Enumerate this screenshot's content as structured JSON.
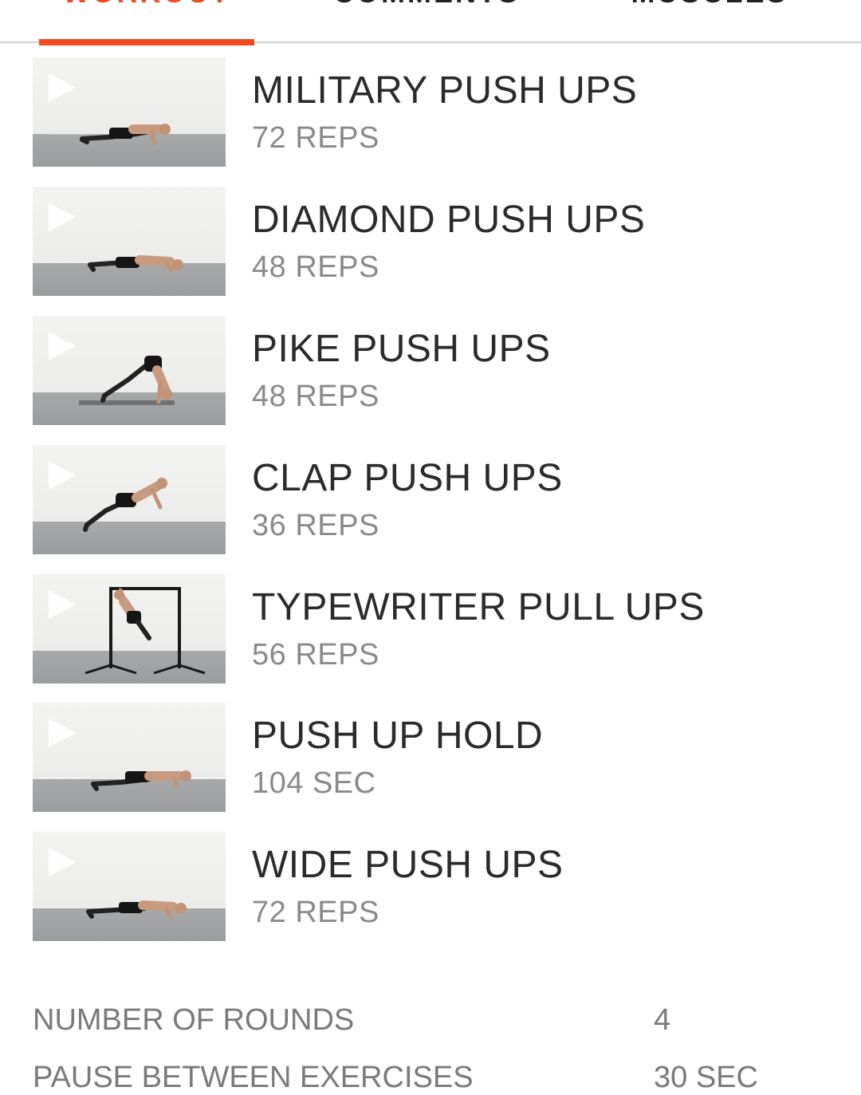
{
  "tabs": [
    {
      "label": "WORKOUT",
      "active": true
    },
    {
      "label": "COMMENTS",
      "active": false
    },
    {
      "label": "MUSCLES",
      "active": false
    }
  ],
  "accent_color": "#f04b1c",
  "exercises": [
    {
      "name": "MILITARY PUSH UPS",
      "amount": "72 REPS",
      "thumb_icon": "play-icon"
    },
    {
      "name": "DIAMOND PUSH UPS",
      "amount": "48 REPS",
      "thumb_icon": "play-icon"
    },
    {
      "name": "PIKE PUSH UPS",
      "amount": "48 REPS",
      "thumb_icon": "play-icon"
    },
    {
      "name": "CLAP PUSH UPS",
      "amount": "36 REPS",
      "thumb_icon": "play-icon"
    },
    {
      "name": "TYPEWRITER PULL UPS",
      "amount": "56 REPS",
      "thumb_icon": "play-icon"
    },
    {
      "name": "PUSH UP HOLD",
      "amount": "104 SEC",
      "thumb_icon": "play-icon"
    },
    {
      "name": "WIDE PUSH UPS",
      "amount": "72 REPS",
      "thumb_icon": "play-icon"
    }
  ],
  "summary": [
    {
      "label": "NUMBER OF ROUNDS",
      "value": "4"
    },
    {
      "label": "PAUSE BETWEEN EXERCISES",
      "value": "30 SEC"
    }
  ]
}
